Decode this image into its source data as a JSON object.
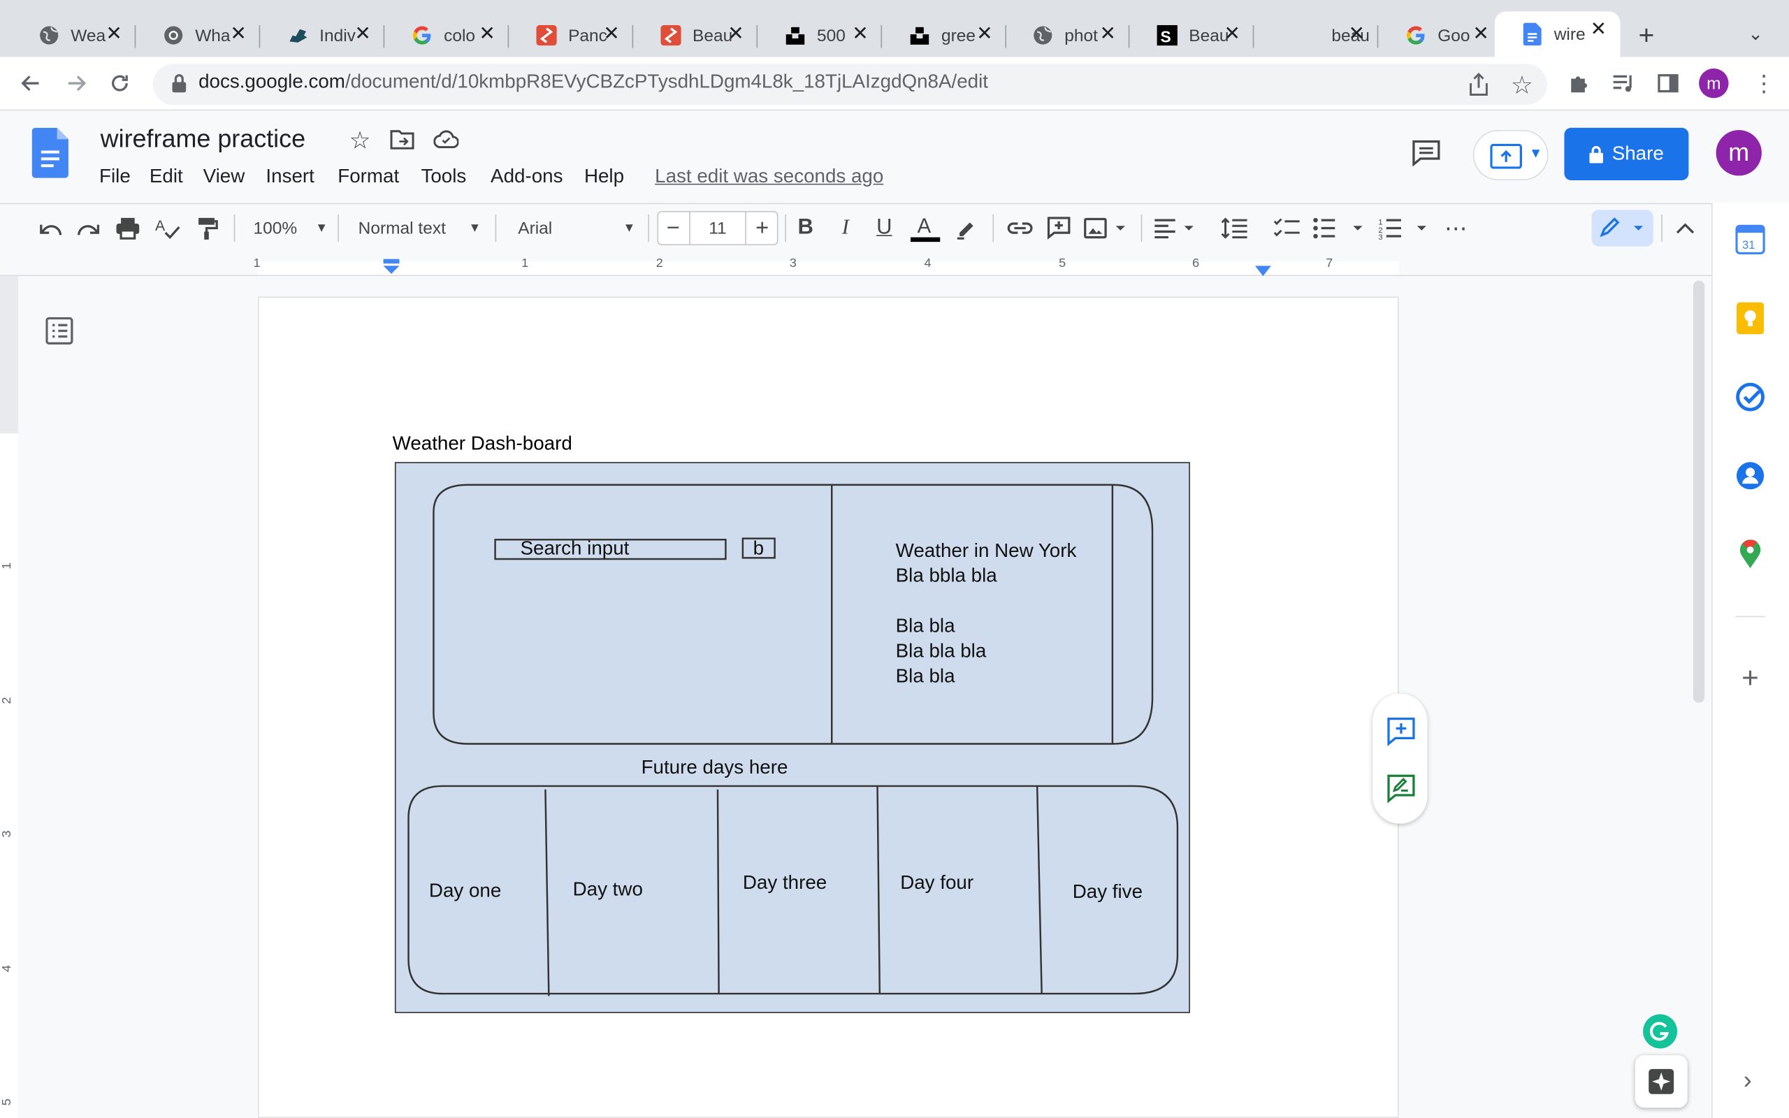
{
  "browser": {
    "tabs": [
      {
        "title": "Wea",
        "icon": "globe-icon"
      },
      {
        "title": "Wha",
        "icon": "chrome-icon"
      },
      {
        "title": "Indiv",
        "icon": "ny-icon"
      },
      {
        "title": "colo",
        "icon": "google-icon"
      },
      {
        "title": "Panc",
        "icon": "pinwheel-icon"
      },
      {
        "title": "Beau",
        "icon": "pinwheel-icon"
      },
      {
        "title": "500",
        "icon": "unsplash-icon"
      },
      {
        "title": "gree",
        "icon": "unsplash-icon"
      },
      {
        "title": "phot",
        "icon": "globe-icon"
      },
      {
        "title": "Beau",
        "icon": "istock-icon"
      },
      {
        "title": "beau",
        "icon": "blank-icon"
      },
      {
        "title": "Goo",
        "icon": "google-icon"
      },
      {
        "title": "wire",
        "icon": "docs-icon",
        "active": true
      }
    ],
    "new_tab": "+",
    "url_host": "docs.google.com",
    "url_path": "/document/d/10kmbpR8EVyCBZcPTysdhLDgm4L8k_18TjLAIzgdQn8A/edit",
    "profile_initial": "m"
  },
  "docs": {
    "title": "wireframe practice",
    "menu": [
      "File",
      "Edit",
      "View",
      "Insert",
      "Format",
      "Tools",
      "Add-ons",
      "Help"
    ],
    "last_edit": "Last edit was seconds ago",
    "share_label": "Share",
    "avatar_initial": "m",
    "toolbar": {
      "zoom": "100%",
      "style": "Normal text",
      "font": "Arial",
      "font_size": "11"
    },
    "ruler_numbers": [
      "1",
      "1",
      "2",
      "3",
      "4",
      "5",
      "6",
      "7"
    ],
    "left_ruler_numbers": [
      "1",
      "2",
      "3",
      "4",
      "5"
    ]
  },
  "wireframe": {
    "heading": "Weather Dash-board",
    "search_placeholder": "Search input",
    "search_button": "b",
    "weather_title": "Weather in New York",
    "line1": "Bla bbla bla",
    "line2": "Bla bla",
    "line3": "Bla bla bla",
    "line4": "Bla bla",
    "future_label": "Future days here",
    "days": [
      "Day one",
      "Day two",
      "Day three",
      "Day four",
      "Day five"
    ]
  },
  "colors": {
    "frame_fill": "#cfdced",
    "share_blue": "#1a73e8",
    "avatar_purple": "#8e24aa"
  }
}
